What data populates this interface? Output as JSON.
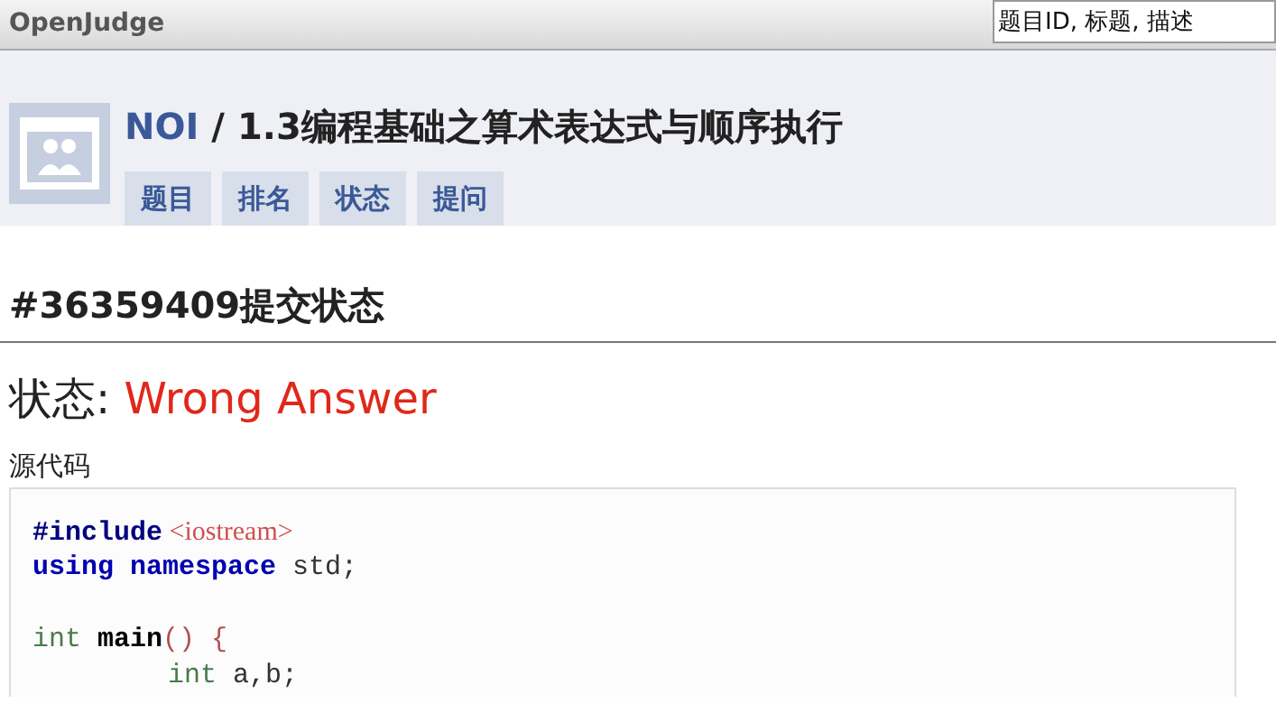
{
  "site": {
    "title": "OpenJudge",
    "search": {
      "placeholder": "题目ID, 标题, 描述"
    }
  },
  "header": {
    "group": "NOI",
    "separator": "/",
    "title": "1.3编程基础之算术表达式与顺序执行",
    "tabs": [
      {
        "label": "题目"
      },
      {
        "label": "排名"
      },
      {
        "label": "状态"
      },
      {
        "label": "提问"
      }
    ]
  },
  "submission": {
    "heading": "#36359409提交状态",
    "status_label": "状态:",
    "status": "Wrong Answer",
    "source_label": "源代码",
    "code": [
      {
        "kind": "code",
        "indented": false,
        "tokens": [
          {
            "kind": "directive",
            "text": "#include"
          },
          {
            "kind": "string",
            "text": " <iostream>"
          }
        ]
      },
      {
        "kind": "code",
        "indented": false,
        "tokens": [
          {
            "kind": "keyword",
            "text": "using namespace"
          },
          {
            "kind": "plain",
            "text": " std;"
          }
        ]
      },
      {
        "kind": "blank"
      },
      {
        "kind": "code",
        "indented": false,
        "tokens": [
          {
            "kind": "type",
            "text": "int"
          },
          {
            "kind": "func",
            "text": " main"
          },
          {
            "kind": "punct",
            "text": "() {"
          }
        ]
      },
      {
        "kind": "code",
        "indented": true,
        "tokens": [
          {
            "kind": "type",
            "text": "int"
          },
          {
            "kind": "plain",
            "text": " a,b;"
          }
        ]
      }
    ]
  }
}
